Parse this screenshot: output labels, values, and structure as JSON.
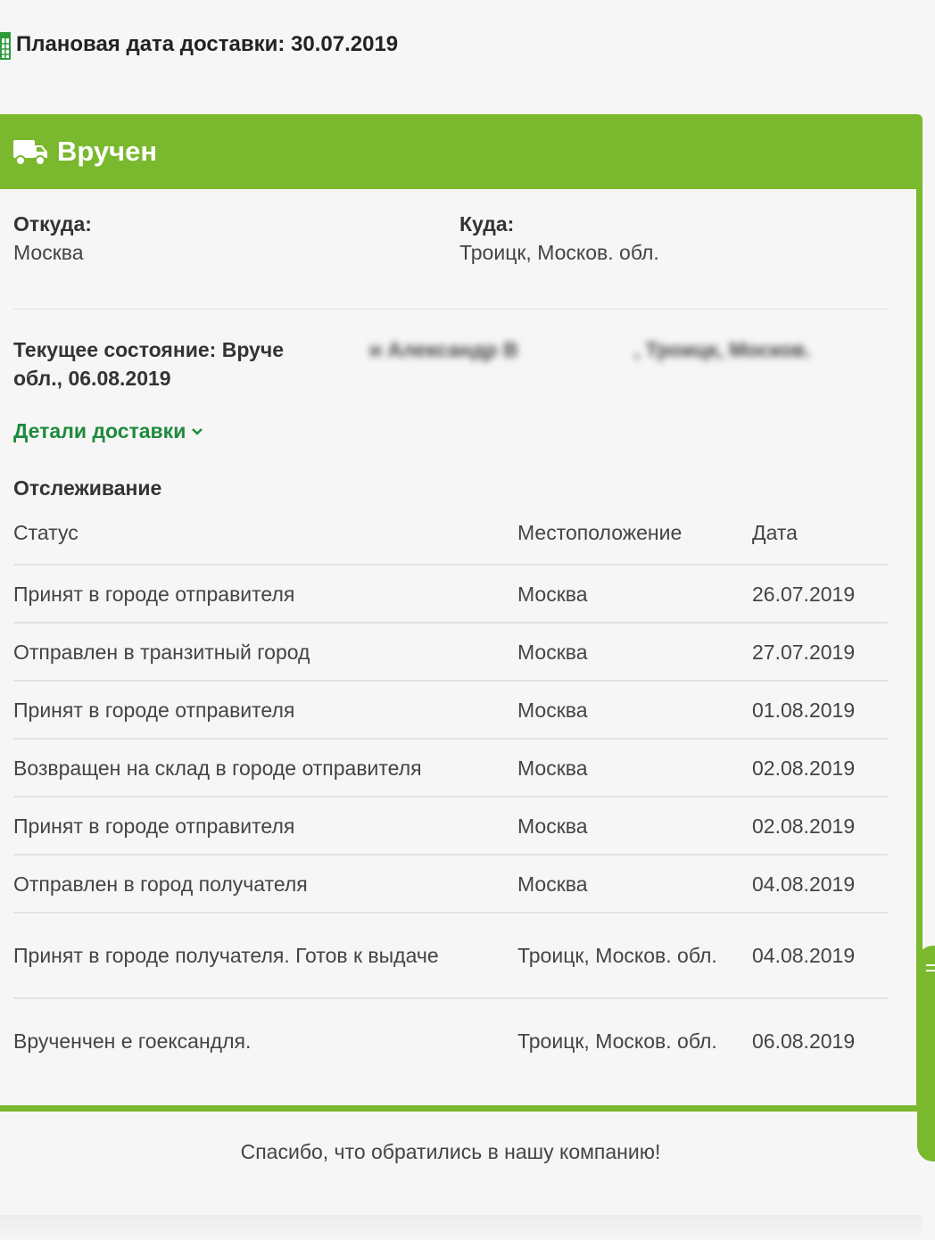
{
  "planned_date": {
    "icon": "calendar-icon",
    "text": "Плановая дата доставки: 30.07.2019"
  },
  "status_card": {
    "icon": "truck-icon",
    "title": "Вручен",
    "accent_color": "#7ab82e",
    "from_label": "Откуда:",
    "from_value": "Москва",
    "to_label": "Куда:",
    "to_value": "Троицк, Москов. обл.",
    "current_state": {
      "prefix": "Текущее состояние: Вруче",
      "blurred_1": "н Александр В",
      "blurred_2": ", Троицк, Москов.",
      "suffix": "обл., 06.08.2019"
    },
    "details_link": "Детали доставки",
    "link_color": "#1e8a3c",
    "tracking_title": "Отслеживание",
    "table": {
      "headers": [
        "Статус",
        "Местоположение",
        "Дата"
      ],
      "rows": [
        {
          "status": "Принят в городе отправителя",
          "location": "Москва",
          "date": "26.07.2019"
        },
        {
          "status": "Отправлен в транзитный город",
          "location": "Москва",
          "date": "27.07.2019"
        },
        {
          "status": "Принят в городе отправителя",
          "location": "Москва",
          "date": "01.08.2019"
        },
        {
          "status": "Возвращен на склад в городе отправителя",
          "location": "Москва",
          "date": "02.08.2019"
        },
        {
          "status": "Принят в городе отправителя",
          "location": "Москва",
          "date": "02.08.2019"
        },
        {
          "status": "Отправлен в город получателя",
          "location": "Москва",
          "date": "04.08.2019"
        },
        {
          "status": "Принят в городе получателя. Готов к выдаче",
          "location": "Троицк, Москов. обл.",
          "date": "04.08.2019"
        },
        {
          "status": "Врученчен е гоександля.",
          "location": "Троицк, Москов. обл.",
          "date": "06.08.2019"
        }
      ]
    }
  },
  "footer": {
    "thanks": "Спасибо, что обратились в нашу компанию!"
  }
}
